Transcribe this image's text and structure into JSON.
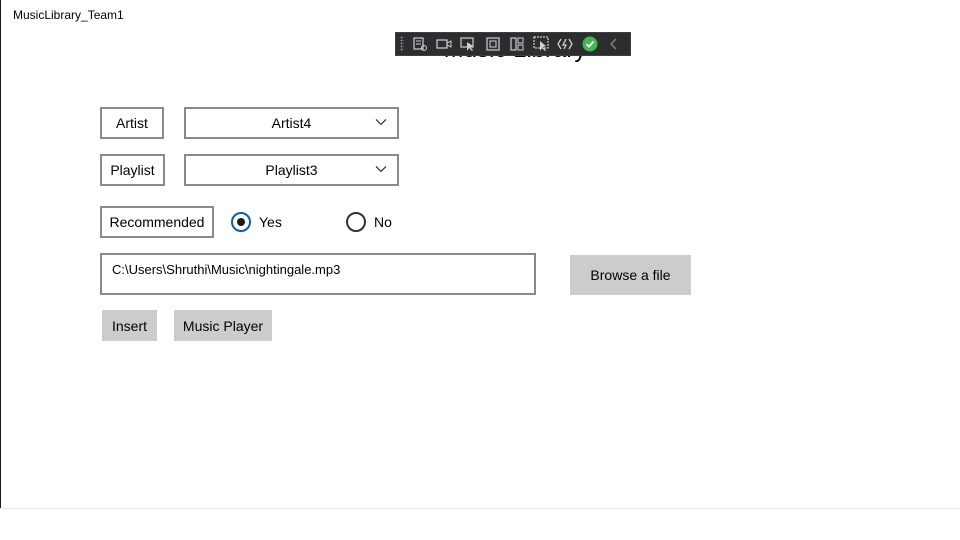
{
  "window": {
    "title": "MusicLibrary_Team1"
  },
  "page": {
    "title": "Music Library"
  },
  "debug_toolbar": {
    "icons": [
      "live-visual-tree-icon",
      "record-icon",
      "select-element-icon",
      "display-layout-adorners-icon",
      "track-focus-icon",
      "preview-selection-icon",
      "hot-reload-icon",
      "status-ok-icon",
      "collapse-icon"
    ]
  },
  "form": {
    "artist": {
      "label": "Artist",
      "selected": "Artist4"
    },
    "playlist": {
      "label": "Playlist",
      "selected": "Playlist3"
    },
    "recommended": {
      "label": "Recommended",
      "options": [
        {
          "label": "Yes",
          "checked": true
        },
        {
          "label": "No",
          "checked": false
        }
      ]
    },
    "file_path": {
      "value": "C:\\Users\\Shruthi\\Music\\nightingale.mp3"
    },
    "browse_button": "Browse a file",
    "insert_button": "Insert",
    "music_player_button": "Music Player"
  },
  "colors": {
    "button_bg": "#cccccc",
    "border": "#8a8a8a",
    "toolbar_bg": "#2d2d30",
    "ok_green": "#3fb950"
  }
}
